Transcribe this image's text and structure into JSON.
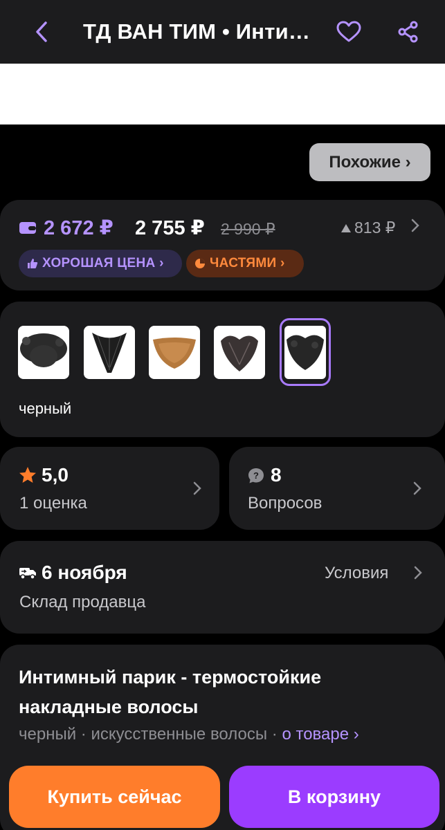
{
  "header": {
    "title": "ТД ВАН ТИМ • Интимный парик - термостойкие накладные волосы",
    "back_icon": "chevron-left-icon",
    "favorite_icon": "heart-icon",
    "share_icon": "share-icon"
  },
  "similar_button": {
    "label": "Похожие ›"
  },
  "price": {
    "wallet_price": "2 672 ₽",
    "price": "2 755 ₽",
    "old_price": "2 990 ₽",
    "price_drop": "813 ₽",
    "good_price_badge": "ХОРОШАЯ ЦЕНА ›",
    "installments_badge": "ЧАСТЯМИ ›"
  },
  "variants": {
    "selected_color": "черный",
    "items": [
      {
        "color": "#2b2b2b",
        "selected": false
      },
      {
        "color": "#1e1e1e",
        "selected": false
      },
      {
        "color": "#b5793d",
        "selected": false
      },
      {
        "color": "#3a3333",
        "selected": false
      },
      {
        "color": "#262626",
        "selected": true
      }
    ]
  },
  "rating": {
    "value": "5,0",
    "count_label": "1 оценка"
  },
  "questions": {
    "count": "8",
    "label": "Вопросов"
  },
  "delivery": {
    "date": "6 ноября",
    "source": "Склад продавца",
    "conditions": "Условия"
  },
  "product": {
    "title": "Интимный парик - термостойкие накладные волосы",
    "attrs": "черный · искусственные волосы ·",
    "about_link": "о товаре ›"
  },
  "actions": {
    "buy_now": "Купить сейчас",
    "add_to_cart": "В корзину"
  },
  "colors": {
    "accent": "#b593ff",
    "orange": "#ff7d2b",
    "purple": "#9b3cff",
    "card": "#1c1c1e"
  }
}
